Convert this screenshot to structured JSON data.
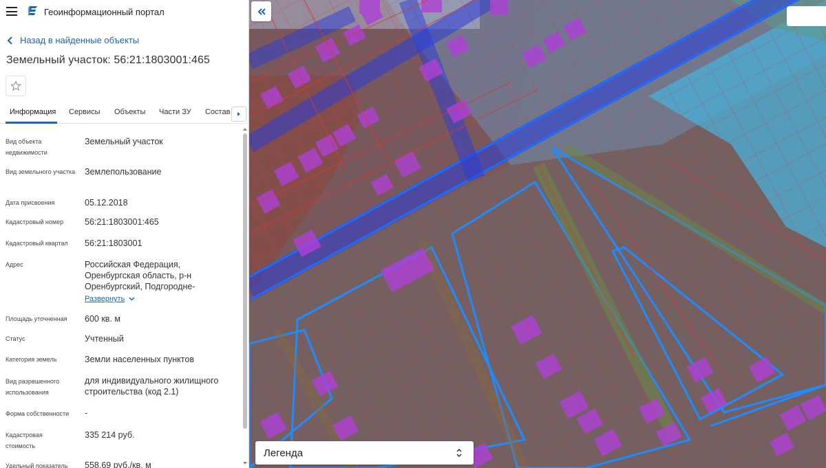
{
  "header": {
    "portal_title": "Геоинформационный портал"
  },
  "back_link": "Назад в найденные объекты",
  "object_title": "Земельный участок: 56:21:1803001:465",
  "tabs": [
    {
      "label": "Информация",
      "active": true
    },
    {
      "label": "Сервисы",
      "active": false
    },
    {
      "label": "Объекты",
      "active": false
    },
    {
      "label": "Части ЗУ",
      "active": false
    },
    {
      "label": "Состав",
      "active": false
    }
  ],
  "properties": [
    {
      "label": "Вид объекта недвижимости",
      "value": "Земельный участок"
    },
    {
      "label": "Вид земельного участка",
      "value": "Землепользование"
    },
    {
      "label": "Дата присвоения",
      "value": "05.12.2018"
    },
    {
      "label": "Кадастровый номер",
      "value": "56:21:1803001:465"
    },
    {
      "label": "Кадастровый квартал",
      "value": "56:21:1803001"
    },
    {
      "label": "Адрес",
      "value": "Российская Федерация, Оренбургская область, р-н Оренбургский, Подгородне-"
    },
    {
      "label": "Площадь уточненная",
      "value": "600 кв. м"
    },
    {
      "label": "Статус",
      "value": "Учтенный"
    },
    {
      "label": "Категория земель",
      "value": "Земли населенных пунктов"
    },
    {
      "label": "Вид разрешенного использования",
      "value": "для индивидуального жилищного строительства (код 2.1)"
    },
    {
      "label": "Форма собственности",
      "value": "-"
    },
    {
      "label": "Кадастровая стоимость",
      "value": "335 214 руб."
    },
    {
      "label": "Удельный показатель",
      "value": "558,69 руб./кв. м"
    }
  ],
  "expand_label": "Развернуть",
  "legend": {
    "label": "Легенда"
  },
  "colors": {
    "accent": "#1a64b7",
    "parcel_outline": "#d43a3a",
    "road_outline": "#1e6cff",
    "building_fill": "#b040d8",
    "water": "#4ab0d8"
  },
  "icons": {
    "menu": "menu-icon",
    "logo": "portal-logo-icon",
    "back": "chevron-left-icon",
    "favorite": "star-icon",
    "tab_next": "chevron-right-icon",
    "expand": "chevron-down-icon",
    "collapse": "double-chevron-left-icon",
    "legend_toggle": "up-down-arrows-icon"
  }
}
